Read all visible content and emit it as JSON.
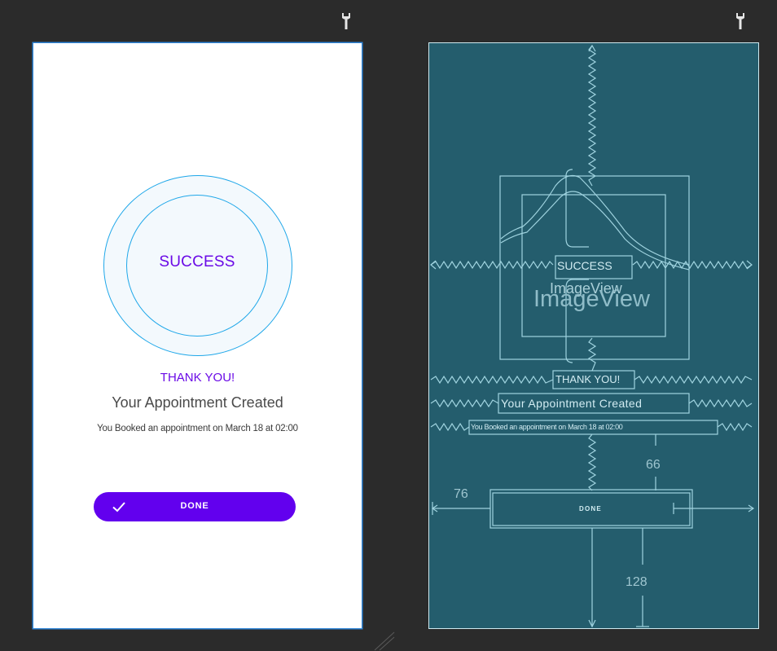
{
  "toolbar": {
    "left_icon": "wrench-icon",
    "right_icon": "wrench-icon"
  },
  "design": {
    "success_label": "SUCCESS",
    "thank_you": "THANK YOU!",
    "appointment_title": "Your Appointment Created",
    "booking_detail": "You Booked an appointment on March 18 at 02:00",
    "done_label": "DONE",
    "done_icon": "check-icon",
    "colors": {
      "accent": "#6200ee",
      "ring": "#1ea7e9",
      "text": "#4a4a4a"
    }
  },
  "blueprint": {
    "success_label": "SUCCESS",
    "imageview_small": "ImageView",
    "imageview_large": "ImageView",
    "thank_you": "THANK YOU!",
    "appointment_title": "Your Appointment Created",
    "booking_detail": "You Booked an appointment on March 18 at 02:00",
    "done_label": "DONE",
    "margin_left": "76",
    "margin_top": "66",
    "margin_bottom": "128",
    "colors": {
      "background": "#245d6d",
      "lines": "#9fd3df"
    }
  }
}
